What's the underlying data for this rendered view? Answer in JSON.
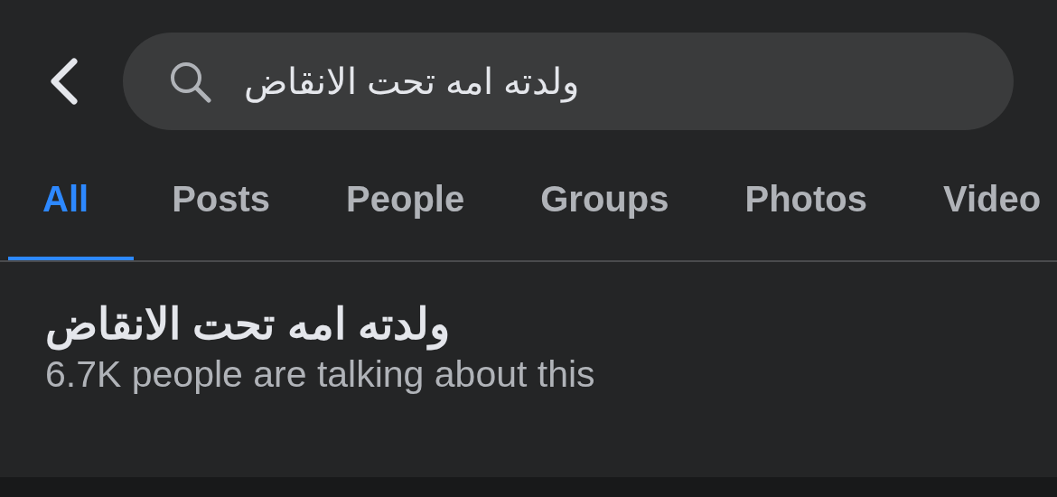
{
  "search": {
    "value": "ولدته امه تحت الانقاض"
  },
  "tabs": [
    {
      "label": "All",
      "selected": true
    },
    {
      "label": "Posts",
      "selected": false
    },
    {
      "label": "People",
      "selected": false
    },
    {
      "label": "Groups",
      "selected": false
    },
    {
      "label": "Photos",
      "selected": false
    },
    {
      "label": "Video",
      "selected": false
    }
  ],
  "result": {
    "title": "ولدته امه تحت الانقاض",
    "subtitle": "6.7K people are talking about this"
  }
}
